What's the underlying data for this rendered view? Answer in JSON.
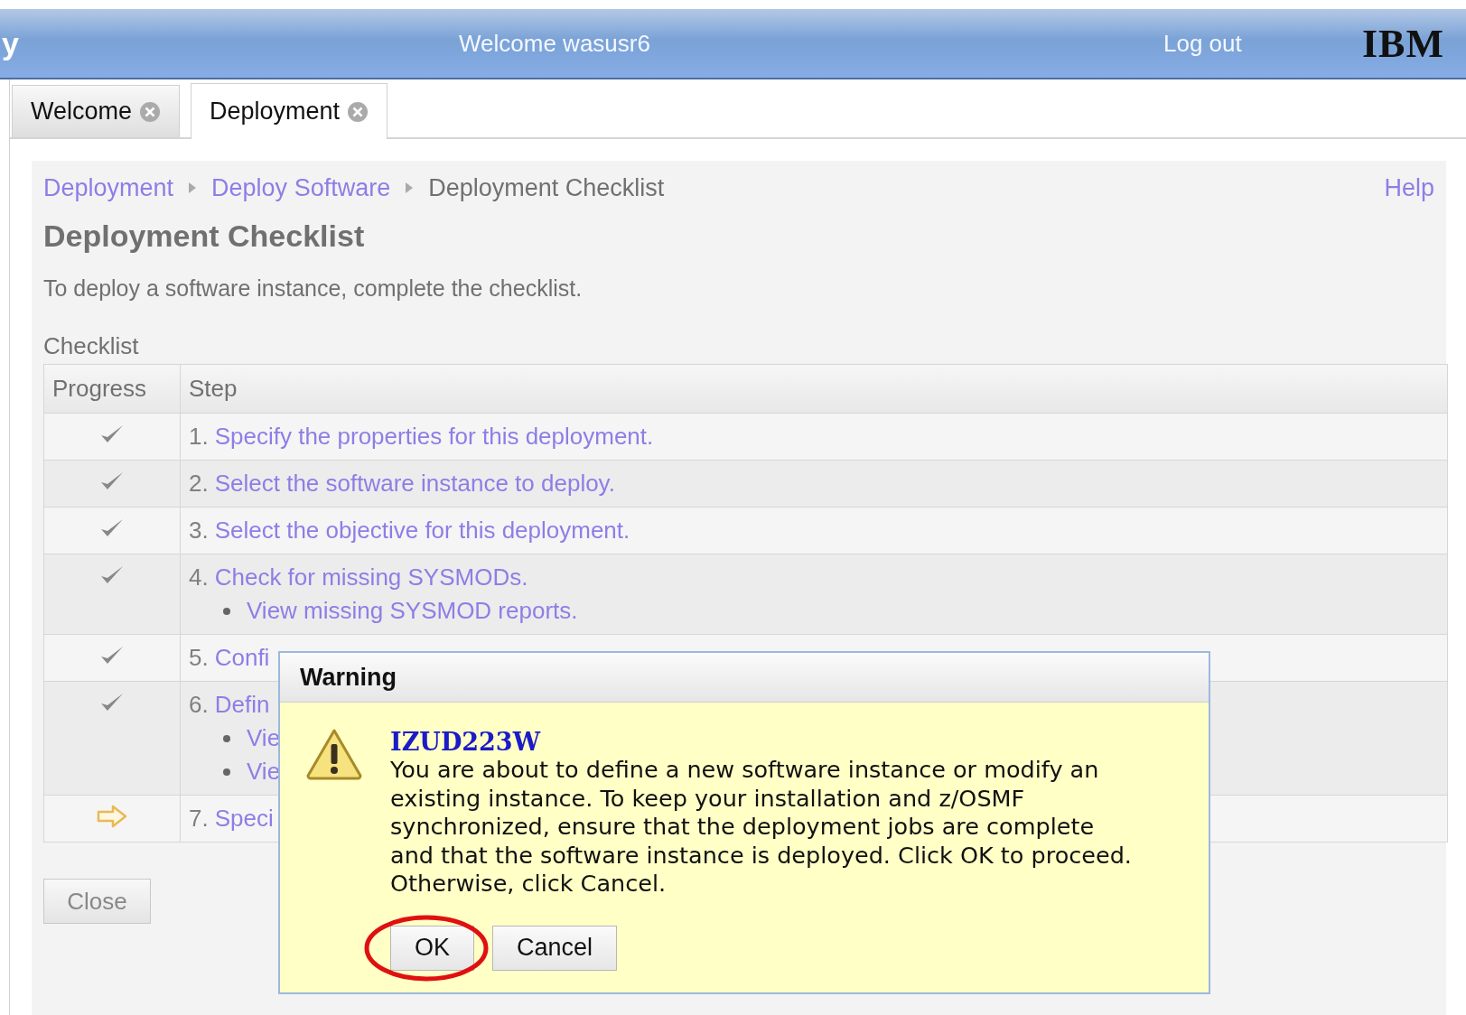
{
  "header": {
    "title_fragment": "y",
    "welcome": "Welcome wasusr6",
    "logout": "Log out",
    "logo": "IBM"
  },
  "tabs": [
    {
      "label": "Welcome",
      "selected": false
    },
    {
      "label": "Deployment",
      "selected": true
    }
  ],
  "breadcrumb": [
    {
      "label": "Deployment",
      "kind": "link"
    },
    {
      "label": "Deploy Software",
      "kind": "link"
    },
    {
      "label": "Deployment Checklist",
      "kind": "current"
    }
  ],
  "help": "Help",
  "page_title": "Deployment Checklist",
  "description": "To deploy a software instance, complete the checklist.",
  "checklist": {
    "label": "Checklist",
    "columns": [
      "Progress",
      "Step"
    ],
    "rows": [
      {
        "kind": "done",
        "number": "1.",
        "text": "Specify the properties for this deployment.",
        "sub_items": []
      },
      {
        "kind": "done",
        "number": "2.",
        "text": "Select the software instance to deploy.",
        "sub_items": []
      },
      {
        "kind": "done",
        "number": "3.",
        "text": "Select the objective for this deployment.",
        "sub_items": []
      },
      {
        "kind": "done",
        "number": "4.",
        "text": "Check for missing SYSMODs.",
        "sub_items": [
          "View missing SYSMOD reports."
        ]
      },
      {
        "kind": "done",
        "number": "5.",
        "text": "Confi",
        "sub_items": []
      },
      {
        "kind": "done",
        "number": "6.",
        "text": "Defin",
        "sub_items": [
          "Vie",
          "Vie"
        ]
      },
      {
        "kind": "current",
        "number": "7.",
        "text": "Speci",
        "sub_items": []
      }
    ]
  },
  "close_button": "Close",
  "dialog": {
    "title": "Warning",
    "code": "IZUD223W",
    "message": "You are about to define a new software instance or modify an existing instance. To keep your installation and z/OSMF synchronized, ensure that the deployment jobs are complete and that the software instance is deployed. Click OK to proceed. Otherwise, click Cancel.",
    "buttons": [
      {
        "label": "OK",
        "circled": true
      },
      {
        "label": "Cancel",
        "circled": false
      }
    ]
  }
}
